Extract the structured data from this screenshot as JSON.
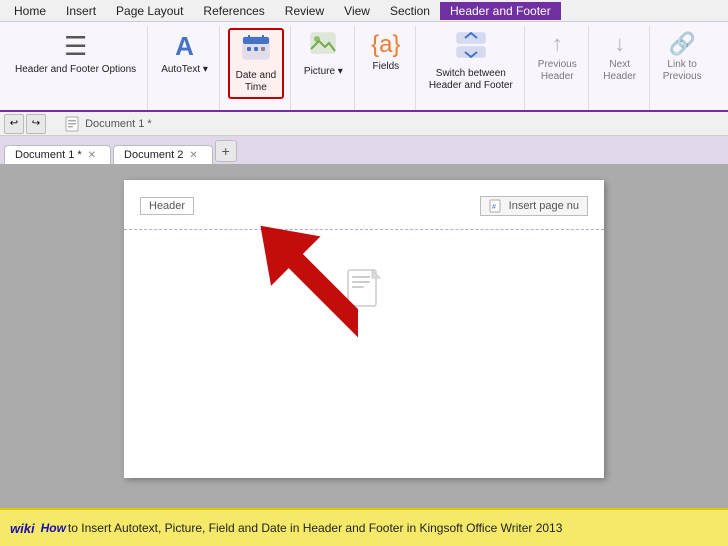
{
  "menubar": {
    "items": [
      "Home",
      "Insert",
      "Page Layout",
      "References",
      "Review",
      "View",
      "Section",
      "Header and Footer"
    ]
  },
  "ribbon": {
    "groups": [
      {
        "name": "header-footer-options",
        "buttons": [
          {
            "id": "header-footer-options",
            "icon": "☰",
            "label": "Header and Footer\nOptions",
            "highlighted": false
          }
        ]
      },
      {
        "name": "autotext-group",
        "buttons": [
          {
            "id": "autotext",
            "icon": "A",
            "label": "AutoText ▾",
            "highlighted": false
          }
        ]
      },
      {
        "name": "datetime-group",
        "buttons": [
          {
            "id": "date-time",
            "icon": "📅",
            "label": "Date and\nTime",
            "highlighted": true
          }
        ]
      },
      {
        "name": "picture-group",
        "buttons": [
          {
            "id": "picture",
            "icon": "🖼",
            "label": "Picture ▾",
            "highlighted": false
          }
        ]
      },
      {
        "name": "fields-group",
        "buttons": [
          {
            "id": "fields",
            "icon": "⬚",
            "label": "Fields",
            "highlighted": false
          }
        ]
      },
      {
        "name": "switch-group",
        "buttons": [
          {
            "id": "switch-header-footer",
            "icon": "⇅",
            "label": "Switch between\nHeader and Footer",
            "highlighted": false
          }
        ]
      },
      {
        "name": "previous-group",
        "buttons": [
          {
            "id": "previous-header",
            "icon": "↑",
            "label": "Previous\nHeader",
            "highlighted": false
          }
        ]
      },
      {
        "name": "next-group",
        "buttons": [
          {
            "id": "next-header",
            "icon": "↓",
            "label": "Next\nHeader",
            "highlighted": false
          }
        ]
      },
      {
        "name": "link-group",
        "buttons": [
          {
            "id": "link-to-previous",
            "icon": "🔗",
            "label": "Link to\nPrevious",
            "highlighted": false
          }
        ]
      }
    ]
  },
  "tabs": {
    "items": [
      {
        "id": "doc1",
        "label": "Document 1 *",
        "closable": true
      },
      {
        "id": "doc2",
        "label": "Document 2",
        "closable": true
      }
    ],
    "add_label": "+"
  },
  "document": {
    "header_label": "Header",
    "insert_page_label": "Insert page nu",
    "body_icon": "📄"
  },
  "caption": {
    "wiki_label": "wiki",
    "how_label": "How",
    "text": " to Insert Autotext, Picture, Field and Date in Header and Footer in Kingsoft Office Writer 2013"
  },
  "arrow": {
    "color": "#c00000"
  }
}
